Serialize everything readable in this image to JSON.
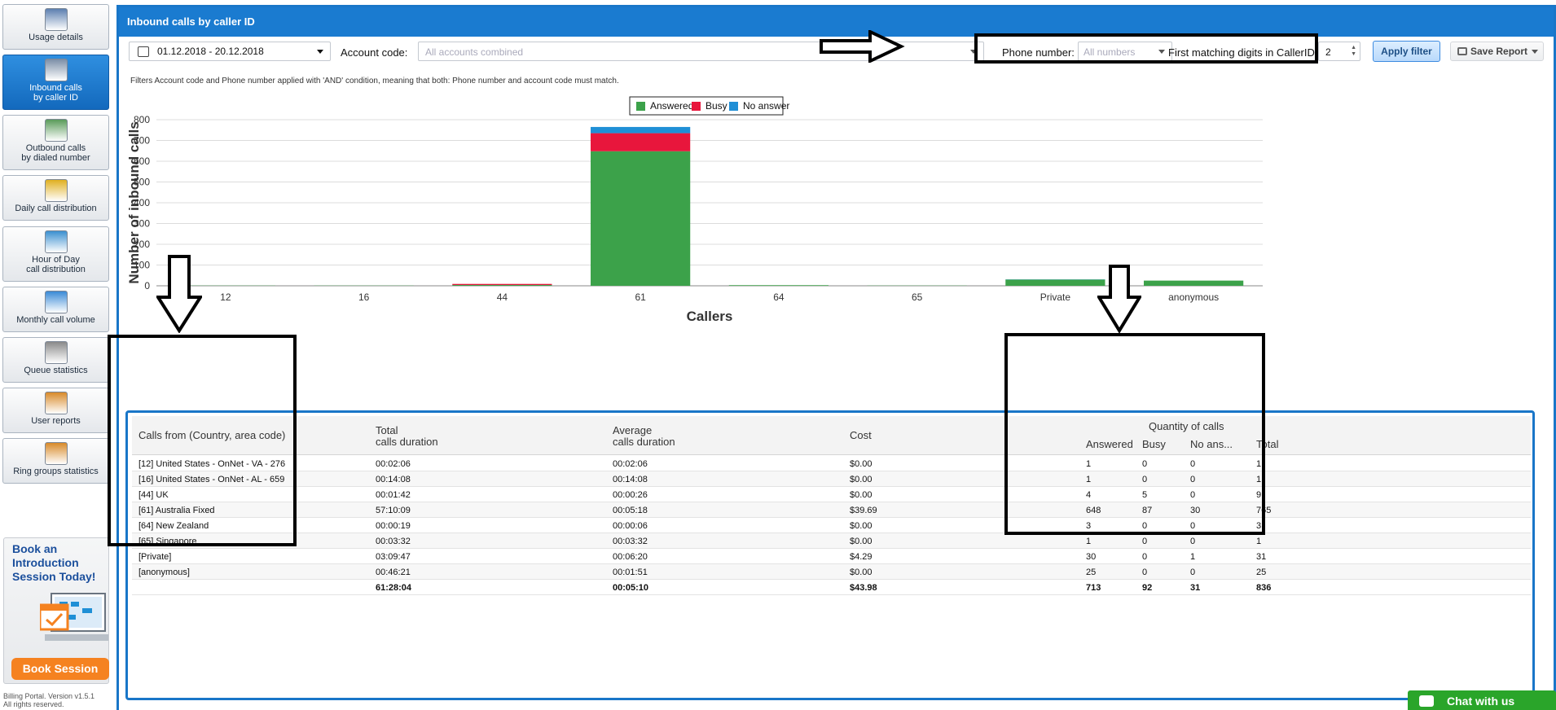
{
  "sidebar": {
    "items": [
      {
        "label1": "Usage details",
        "label2": "",
        "icon": "notebook-icon"
      },
      {
        "label1": "Inbound calls",
        "label2": "by caller ID",
        "icon": "phone-list-icon"
      },
      {
        "label1": "Outbound calls",
        "label2": "by dialed number",
        "icon": "phone-arrow-icon"
      },
      {
        "label1": "Daily call distribution",
        "label2": "",
        "icon": "calendar-10-icon"
      },
      {
        "label1": "Hour of Day",
        "label2": "call distribution",
        "icon": "bar-chart-icon"
      },
      {
        "label1": "Monthly call volume",
        "label2": "",
        "icon": "calendar-grid-icon"
      },
      {
        "label1": "Queue statistics",
        "label2": "",
        "icon": "megaphone-icon"
      },
      {
        "label1": "User reports",
        "label2": "",
        "icon": "user-icon"
      },
      {
        "label1": "Ring groups statistics",
        "label2": "",
        "icon": "user-group-icon"
      }
    ],
    "active_index": 1,
    "promo": {
      "title": "Book an Introduction Session Today!",
      "button": "Book Session"
    },
    "footer_line1": "Billing Portal. Version v1.5.1",
    "footer_line2": "All rights reserved."
  },
  "header": {
    "title": "Inbound calls by caller ID"
  },
  "filters": {
    "date_range": "01.12.2018 - 20.12.2018",
    "account_label": "Account code:",
    "account_placeholder": "All accounts combined",
    "phone_label": "Phone number:",
    "phone_placeholder": "All numbers",
    "digits_label": "First matching digits in CallerID:",
    "digits_value": "2",
    "apply_label": "Apply filter",
    "save_label": "Save Report",
    "note": "Filters Account code and Phone number applied with 'AND' condition, meaning that both: Phone number and account code must match."
  },
  "chart_data": {
    "type": "bar",
    "stacked": true,
    "categories": [
      "12",
      "16",
      "44",
      "61",
      "64",
      "65",
      "Private",
      "anonymous"
    ],
    "series": [
      {
        "name": "Answered",
        "color": "#3ca24a",
        "values": [
          1,
          1,
          4,
          648,
          3,
          1,
          30,
          25
        ]
      },
      {
        "name": "Busy",
        "color": "#e8163c",
        "values": [
          0,
          0,
          5,
          87,
          0,
          0,
          0,
          0
        ]
      },
      {
        "name": "No answer",
        "color": "#1f8fd6",
        "values": [
          0,
          0,
          0,
          30,
          0,
          0,
          1,
          0
        ]
      }
    ],
    "xlabel": "Callers",
    "ylabel": "Number of inbound calls",
    "ylim": [
      0,
      800
    ],
    "yticks": [
      0,
      100,
      200,
      300,
      400,
      500,
      600,
      700,
      800
    ],
    "legend": "top-center",
    "grid": true
  },
  "table": {
    "headers": {
      "from": "Calls from (Country, area code)",
      "total1": "Total",
      "total2": "calls duration",
      "avg1": "Average",
      "avg2": "calls duration",
      "cost": "Cost",
      "qty": "Quantity of calls",
      "answered": "Answered",
      "busy": "Busy",
      "noans": "No ans...",
      "total": "Total"
    },
    "rows": [
      [
        "[12] United States - OnNet - VA - 276",
        "00:02:06",
        "00:02:06",
        "$0.00",
        "1",
        "0",
        "0",
        "1"
      ],
      [
        "[16] United States - OnNet - AL - 659",
        "00:14:08",
        "00:14:08",
        "$0.00",
        "1",
        "0",
        "0",
        "1"
      ],
      [
        "[44] UK",
        "00:01:42",
        "00:00:26",
        "$0.00",
        "4",
        "5",
        "0",
        "9"
      ],
      [
        "[61] Australia Fixed",
        "57:10:09",
        "00:05:18",
        "$39.69",
        "648",
        "87",
        "30",
        "765"
      ],
      [
        "[64] New Zealand",
        "00:00:19",
        "00:00:06",
        "$0.00",
        "3",
        "0",
        "0",
        "3"
      ],
      [
        "[65] Singapore",
        "00:03:32",
        "00:03:32",
        "$0.00",
        "1",
        "0",
        "0",
        "1"
      ],
      [
        "[Private]",
        "03:09:47",
        "00:06:20",
        "$4.29",
        "30",
        "0",
        "1",
        "31"
      ],
      [
        "[anonymous]",
        "00:46:21",
        "00:01:51",
        "$0.00",
        "25",
        "0",
        "0",
        "25"
      ]
    ],
    "totals": [
      "",
      "61:28:04",
      "00:05:10",
      "$43.98",
      "713",
      "92",
      "31",
      "836"
    ]
  },
  "chat": {
    "label": "Chat with us"
  }
}
